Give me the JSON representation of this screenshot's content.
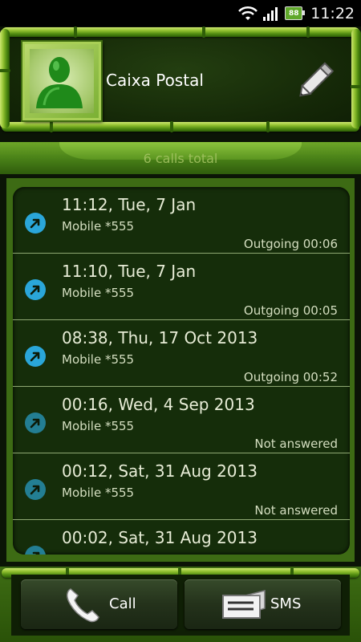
{
  "status_bar": {
    "time": "11:22",
    "battery": "88",
    "icons": [
      "wifi-icon",
      "signal-icon",
      "battery-icon"
    ]
  },
  "contact": {
    "name": "Caixa Postal",
    "avatar_icon": "contact-avatar-icon",
    "edit_icon": "pencil-icon"
  },
  "summary": {
    "total_calls": "6 calls total"
  },
  "calls": [
    {
      "time": "11:12, Tue, 7 Jan",
      "type": "Mobile *555",
      "status": "Outgoing 00:06",
      "icon": "outgoing-call-icon",
      "missed": false
    },
    {
      "time": "11:10, Tue, 7 Jan",
      "type": "Mobile *555",
      "status": "Outgoing 00:05",
      "icon": "outgoing-call-icon",
      "missed": false
    },
    {
      "time": "08:38, Thu, 17 Oct 2013",
      "type": "Mobile *555",
      "status": "Outgoing 00:52",
      "icon": "outgoing-call-icon",
      "missed": false
    },
    {
      "time": "00:16, Wed, 4 Sep 2013",
      "type": "Mobile *555",
      "status": "Not answered",
      "icon": "outgoing-call-icon",
      "missed": true
    },
    {
      "time": "00:12, Sat, 31 Aug 2013",
      "type": "Mobile *555",
      "status": "Not answered",
      "icon": "outgoing-call-icon",
      "missed": true
    },
    {
      "time": "00:02, Sat, 31 Aug 2013",
      "type": "",
      "status": "",
      "icon": "outgoing-call-icon",
      "missed": true
    }
  ],
  "actions": {
    "call_label": "Call",
    "sms_label": "SMS"
  },
  "colors": {
    "bamboo_light": "#cde770",
    "bamboo_dark": "#2b5c05",
    "list_bg": "#152d0a",
    "outgoing_icon": "#2aa6d9",
    "missed_icon": "#237e93"
  }
}
